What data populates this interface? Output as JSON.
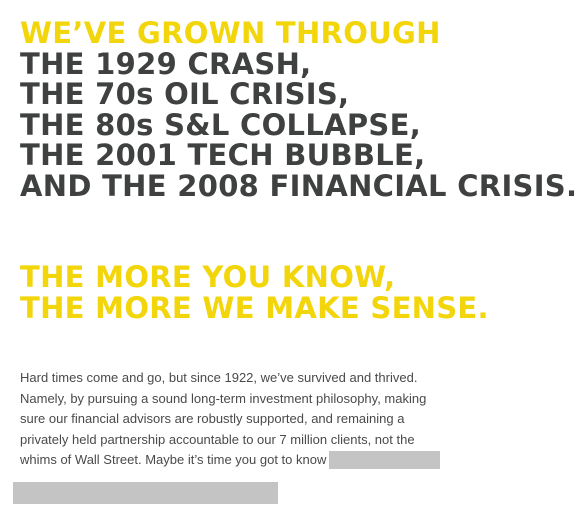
{
  "headline": {
    "lead": "WE’VE GROWN THROUGH",
    "events": [
      "THE 1929 CRASH,",
      "THE 70s OIL CRISIS,",
      "THE 80s S&L COLLAPSE,",
      "THE 2001 TECH BUBBLE,",
      "AND THE 2008 FINANCIAL CRISIS."
    ]
  },
  "tagline": [
    "THE MORE YOU KNOW,",
    "THE MORE WE MAKE SENSE."
  ],
  "body": {
    "lines": [
      "Hard times come and go, but since 1922, we’ve survived and thrived.",
      "Namely, by pursuing a sound long-term investment philosophy, making",
      "sure our financial advisors are robustly supported, and remaining a",
      "privately held partnership accountable to our 7 million clients, not the",
      "whims of Wall Street. Maybe it’s time you got to know"
    ]
  },
  "colors": {
    "accent_yellow": "#f2d50a",
    "headline_gray": "#3f4140",
    "body_text": "#4a4a4a",
    "redaction": "#c4c4c4"
  }
}
